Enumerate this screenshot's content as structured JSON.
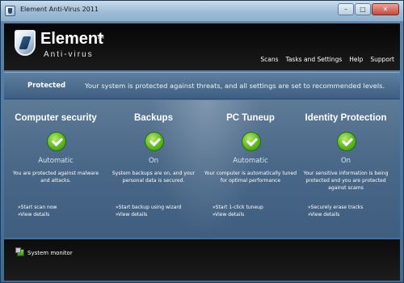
{
  "window": {
    "title": "Element Anti-Virus 2011",
    "controls": {
      "minimize": "–",
      "maximize": "□",
      "close": "✕"
    }
  },
  "header": {
    "brand": "Element",
    "tm": "TM",
    "subtitle": "Anti-virus",
    "nav": [
      "Scans",
      "Tasks and Settings",
      "Help",
      "Support"
    ]
  },
  "status": {
    "label": "Protected",
    "message": "Your system is protected against threats, and all settings are set to recommended levels."
  },
  "columns": [
    {
      "title": "Computer security",
      "state": "Automatic",
      "description": "You are protected against malware and attacks.",
      "links": [
        "»Start scan now",
        "»View details"
      ]
    },
    {
      "title": "Backups",
      "state": "On",
      "description": "System backups are on, and your personal data is secured.",
      "links": [
        "»Start backup using wizard",
        "»View details"
      ]
    },
    {
      "title": "PC Tuneup",
      "state": "Automatic",
      "description": "Your computer is automatically tuned for optimal performance",
      "links": [
        "»Start 1-click tuneup",
        "»View details"
      ]
    },
    {
      "title": "Identity Protection",
      "state": "On",
      "description": "Your sensitive information is being protected and you are protected against scams",
      "links": [
        "»Securely erase tracks",
        "»View details"
      ]
    }
  ],
  "footer": {
    "monitor_label": "System monitor"
  },
  "colors": {
    "accent_green": "#5cb722",
    "header_black": "#050505",
    "panel_blue": "#4a6888"
  }
}
